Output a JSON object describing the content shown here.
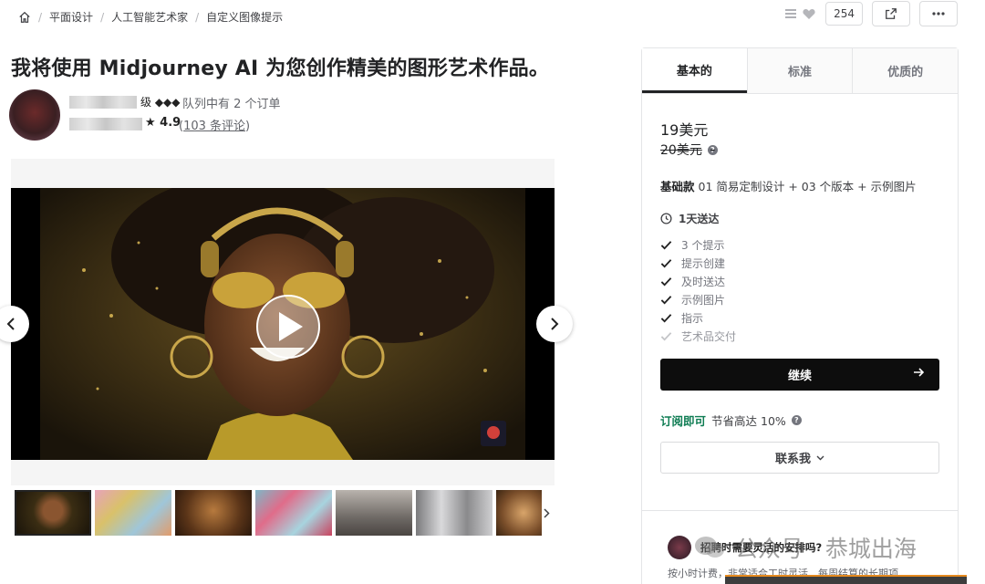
{
  "breadcrumb": {
    "items": [
      "平面设计",
      "人工智能艺术家",
      "自定义图像提示"
    ]
  },
  "top_actions": {
    "like_count": "254"
  },
  "gig": {
    "title": "我将使用 Midjourney AI 为您创作精美的图形艺术作品。"
  },
  "seller": {
    "level_suffix": "级 ◆◆◆",
    "queue": "队列中有 2 个订单",
    "rating": "★ 4.9",
    "reviews_open": "(",
    "reviews_link": "103 条评论",
    "reviews_close": ")"
  },
  "packages": {
    "tabs": [
      "基本的",
      "标准",
      "优质的"
    ],
    "price": "19美元",
    "old_price": "20美元",
    "desc_bold": "基础款",
    "desc": " 01 简易定制设计 + 03 个版本 + 示例图片",
    "delivery": "1天送达",
    "features": [
      {
        "label": "3 个提示",
        "included": true
      },
      {
        "label": "提示创建",
        "included": true
      },
      {
        "label": "及时送达",
        "included": true
      },
      {
        "label": "示例图片",
        "included": true
      },
      {
        "label": "指示",
        "included": true
      },
      {
        "label": "艺术品交付",
        "included": false
      }
    ],
    "continue_label": "继续",
    "subscribe_label": "订阅即可",
    "subscribe_text": "节省高达 10%",
    "contact_label": "联系我"
  },
  "promo": {
    "title": "招聘时需要灵活的安排吗?",
    "text": "按小时计费，非常适合工时灵活、每周结算的长期项"
  },
  "watermark": {
    "text": "公众号 · 恭城出海"
  },
  "colors": {
    "primary_text": "#222325",
    "accent_green": "#0e7c53",
    "button_black": "#0d0d0d",
    "border": "#e4e5e7"
  }
}
